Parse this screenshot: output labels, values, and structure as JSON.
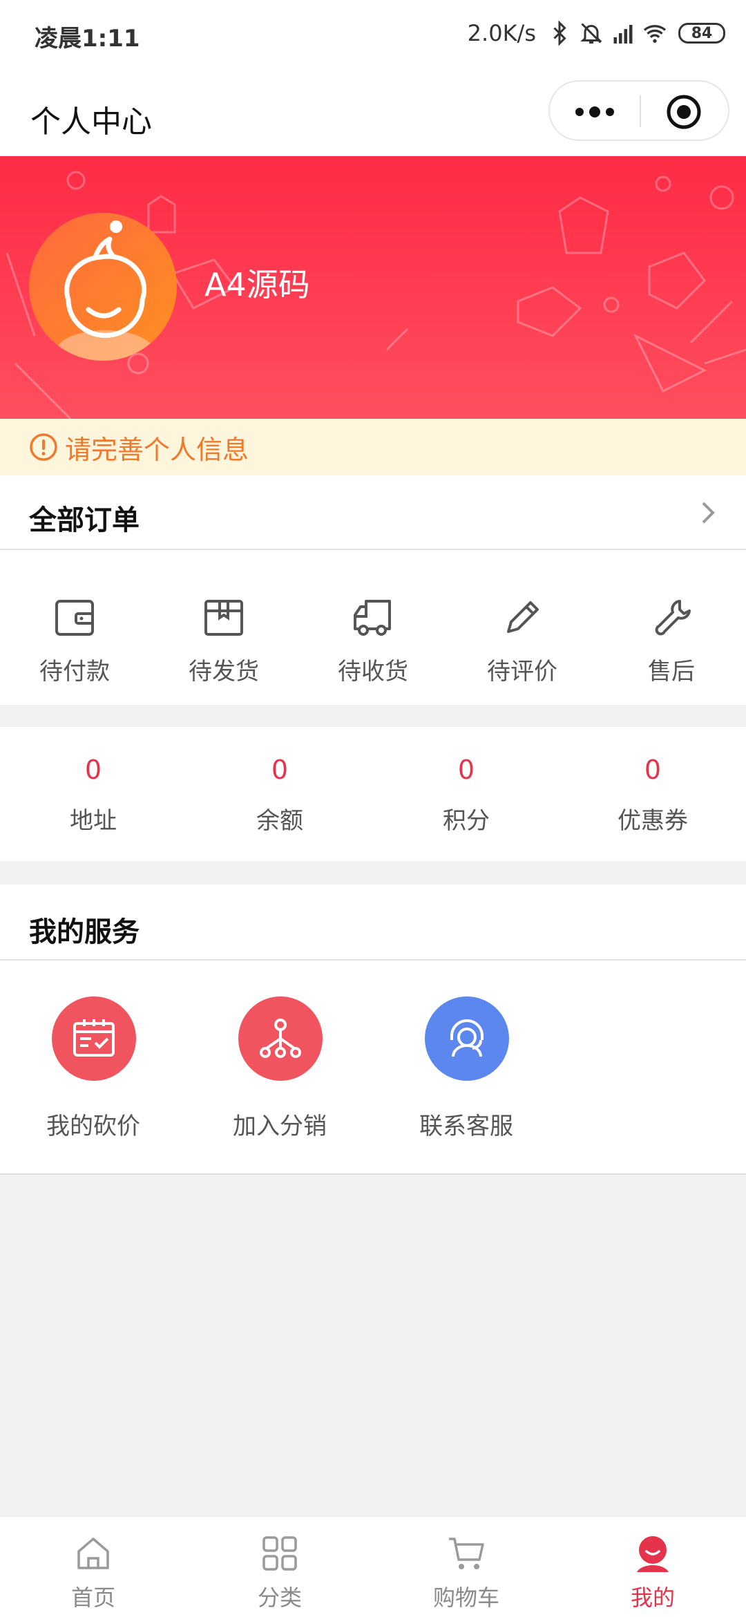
{
  "status_bar": {
    "time": "凌晨1:11",
    "network_speed": "2.0K/s",
    "battery": "84",
    "icons": [
      "bluetooth-icon",
      "mute-bell-icon",
      "hd-signal-icon",
      "wifi-icon",
      "battery-icon"
    ]
  },
  "navbar": {
    "title": "个人中心",
    "more_icon": "more-dots-icon",
    "close_icon": "target-close-icon"
  },
  "profile": {
    "username": "A4源码",
    "avatar_icon": "pomegranate-avatar-icon"
  },
  "notice": {
    "text": "请完善个人信息",
    "icon": "alert-circle-icon",
    "color": "#f07a2c"
  },
  "orders": {
    "title": "全部订单",
    "statuses": [
      {
        "label": "待付款",
        "icon": "wallet-icon"
      },
      {
        "label": "待发货",
        "icon": "package-icon"
      },
      {
        "label": "待收货",
        "icon": "truck-icon"
      },
      {
        "label": "待评价",
        "icon": "pencil-icon"
      },
      {
        "label": "售后",
        "icon": "wrench-icon"
      }
    ]
  },
  "stats": [
    {
      "value": "0",
      "label": "地址"
    },
    {
      "value": "0",
      "label": "余额"
    },
    {
      "value": "0",
      "label": "积分"
    },
    {
      "value": "0",
      "label": "优惠券"
    }
  ],
  "services": {
    "title": "我的服务",
    "items": [
      {
        "label": "我的砍价",
        "icon": "calendar-check-icon",
        "color": "#f0545e"
      },
      {
        "label": "加入分销",
        "icon": "network-tree-icon",
        "color": "#f0545e"
      },
      {
        "label": "联系客服",
        "icon": "headset-agent-icon",
        "color": "#5b87ee"
      }
    ]
  },
  "tabbar": {
    "active_color": "#e5334b",
    "items": [
      {
        "label": "首页",
        "icon": "home-icon"
      },
      {
        "label": "分类",
        "icon": "grid-icon"
      },
      {
        "label": "购物车",
        "icon": "cart-icon"
      },
      {
        "label": "我的",
        "icon": "user-face-icon"
      }
    ]
  },
  "theme": {
    "accent": "#ff2b45",
    "value_red": "#e5334b",
    "background": "#f2f2f2"
  }
}
